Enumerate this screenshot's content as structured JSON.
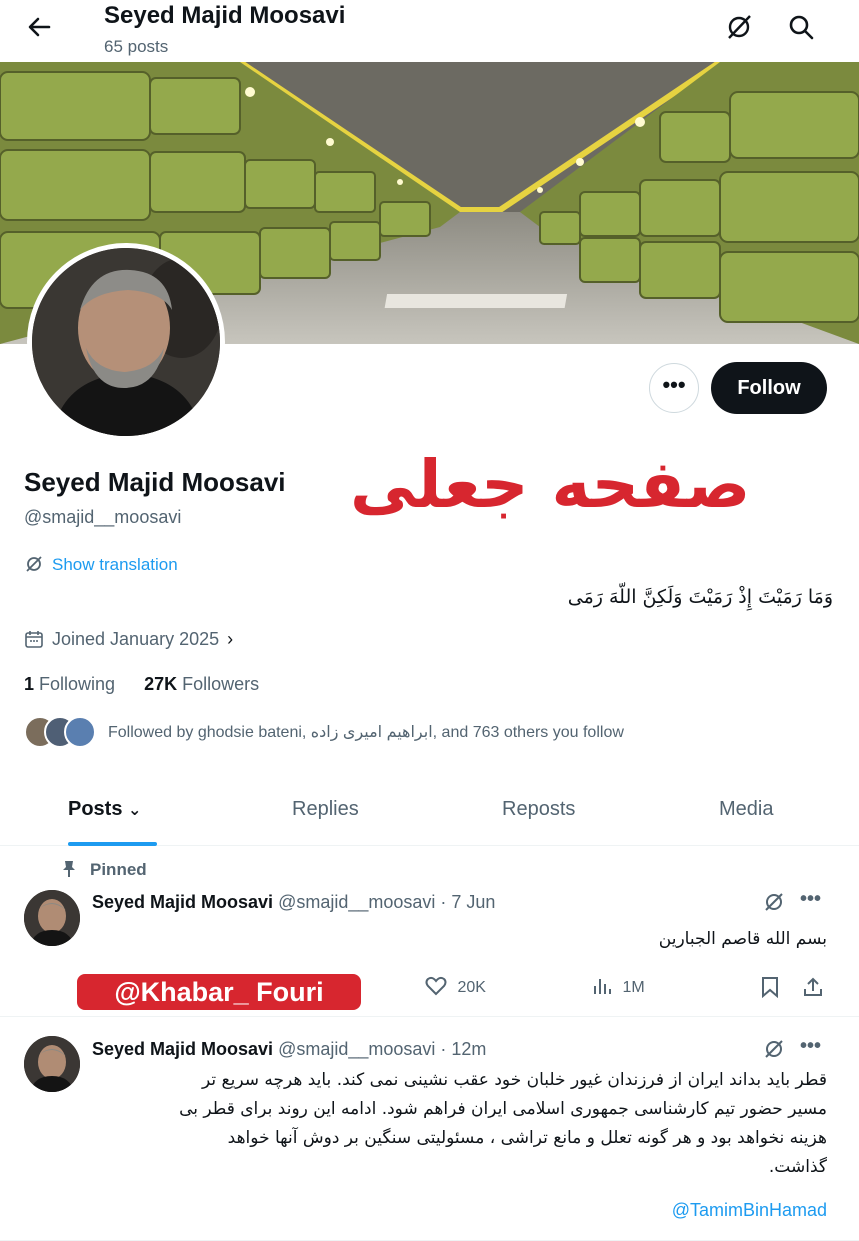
{
  "header": {
    "title": "Seyed Majid Moosavi",
    "posts_count": "65 posts"
  },
  "profile": {
    "name": "Seyed Majid Moosavi",
    "handle": "@smajid__moosavi",
    "fake_label": "صفحه جعلی",
    "show_translation": "Show translation",
    "bio": "وَمَا رَمَیْتَ إِذْ رَمَیْتَ وَلَکِنَّ اللّهَ رَمَی",
    "joined": "Joined January 2025",
    "following_count": "1",
    "following_label": "Following",
    "followers_count": "27K",
    "followers_label": "Followers",
    "followed_by": "Followed by ghodsie bateni, ابراهیم امیری زاده, and 763 others you follow",
    "follow_label": "Follow",
    "more_label": "•••"
  },
  "tabs": [
    {
      "label": "Posts"
    },
    {
      "label": "Replies"
    },
    {
      "label": "Reposts"
    },
    {
      "label": "Media"
    }
  ],
  "tweets": [
    {
      "pinned_label": "Pinned",
      "name": "Seyed Majid Moosavi",
      "meta": "@smajid__moosavi · 7 Jun",
      "body": "بسم الله قاصم الجبارین",
      "likes": "20K",
      "views": "1M"
    },
    {
      "name": "Seyed Majid Moosavi",
      "meta": "@smajid__moosavi · 12m",
      "body_lines": [
        "قطر باید بداند ایران از فرزندان غیور خلبان خود عقب نشینی نمی کند. باید هرچه سریع تر",
        "مسیر حضور تیم کارشناسی جمهوری اسلامی ایران فراهم شود. ادامه این روند برای قطر بی",
        "هزینه نخواهد بود و هر گونه تعلل و مانع تراشی ، مسئولیتی سنگین بر دوش آنها خواهد",
        "گذاشت."
      ],
      "mention": "@TamimBinHamad"
    }
  ],
  "watermark": "@Khabar_ Fouri",
  "colors": {
    "accent": "#1d9bf0",
    "watermark_red": "#d7262f",
    "follow_bg": "#0f1419"
  }
}
